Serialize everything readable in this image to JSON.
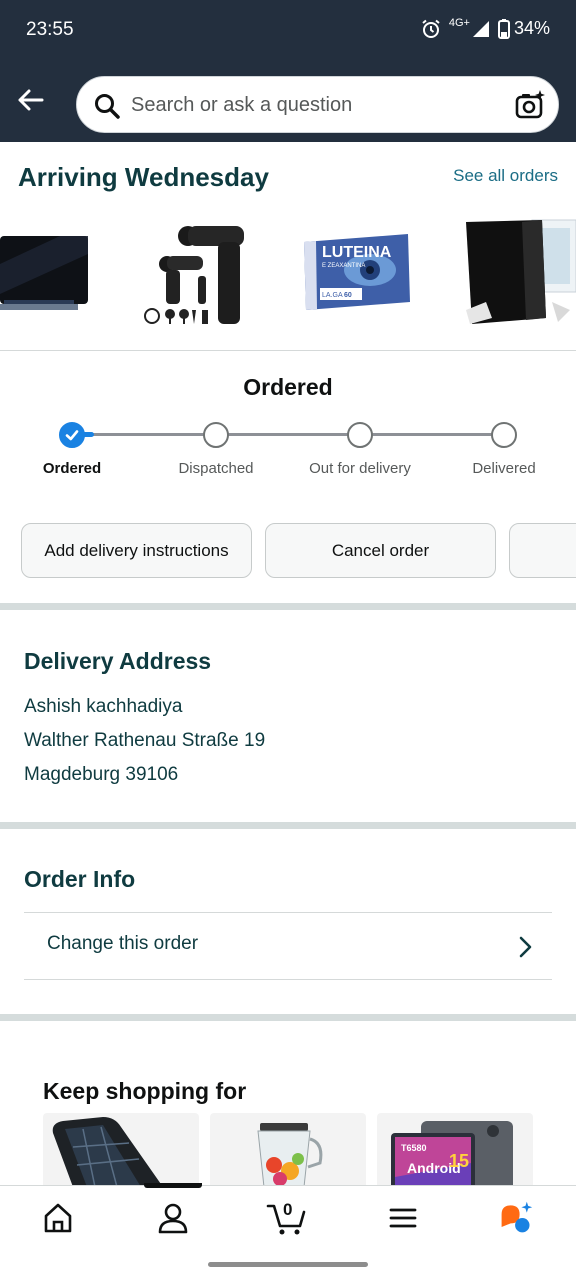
{
  "status_bar": {
    "time": "23:55",
    "network": "4G+",
    "battery": "34%",
    "icons": [
      "alarm-icon",
      "signal-icon",
      "battery-icon"
    ]
  },
  "search": {
    "placeholder": "Search or ask a question",
    "icons": [
      "back-arrow-icon",
      "search-icon",
      "camera-sparkle-icon"
    ]
  },
  "arriving": {
    "title": "Arriving Wednesday",
    "see_all": "See all orders",
    "products": [
      {
        "name": "privacy-screen-filter",
        "box_title": ""
      },
      {
        "name": "massage-gun",
        "box_title": ""
      },
      {
        "name": "luteina-supplement",
        "box_title": "LUTEINA",
        "box_subtitle": "E ZEAXANTINA",
        "brand": "LA.GA",
        "count": "60"
      },
      {
        "name": "window-blackout-blind",
        "box_title": ""
      }
    ]
  },
  "tracker": {
    "current_status": "Ordered",
    "steps": [
      "Ordered",
      "Dispatched",
      "Out for delivery",
      "Delivered"
    ],
    "active_step": 0
  },
  "actions": {
    "add_instructions": "Add delivery instructions",
    "cancel_order": "Cancel order"
  },
  "address": {
    "title": "Delivery Address",
    "name": "Ashish kachhadiya",
    "street": "Walther Rathenau Straße 19",
    "city": "Magdeburg 39106"
  },
  "order_info": {
    "title": "Order Info",
    "change_order": "Change this order"
  },
  "keep_shopping": {
    "title": "Keep shopping for",
    "items": [
      {
        "name": "solar-power-bank"
      },
      {
        "name": "blender"
      },
      {
        "name": "android-tablet",
        "label_android": "Android",
        "label_version": "15",
        "label_model": "T6580"
      }
    ]
  },
  "bottom_nav": {
    "items": [
      "home-icon",
      "account-icon",
      "cart-icon",
      "menu-icon",
      "rufus-ai-icon"
    ],
    "cart_count": "0",
    "active_item": "account-icon"
  },
  "colors": {
    "header_bg": "#232f3e",
    "heading": "#0f3b40",
    "link": "#1b6d85",
    "progress_active": "#1a82e2",
    "ai_orange": "#ff6a13",
    "ai_blue": "#1a82e2"
  }
}
